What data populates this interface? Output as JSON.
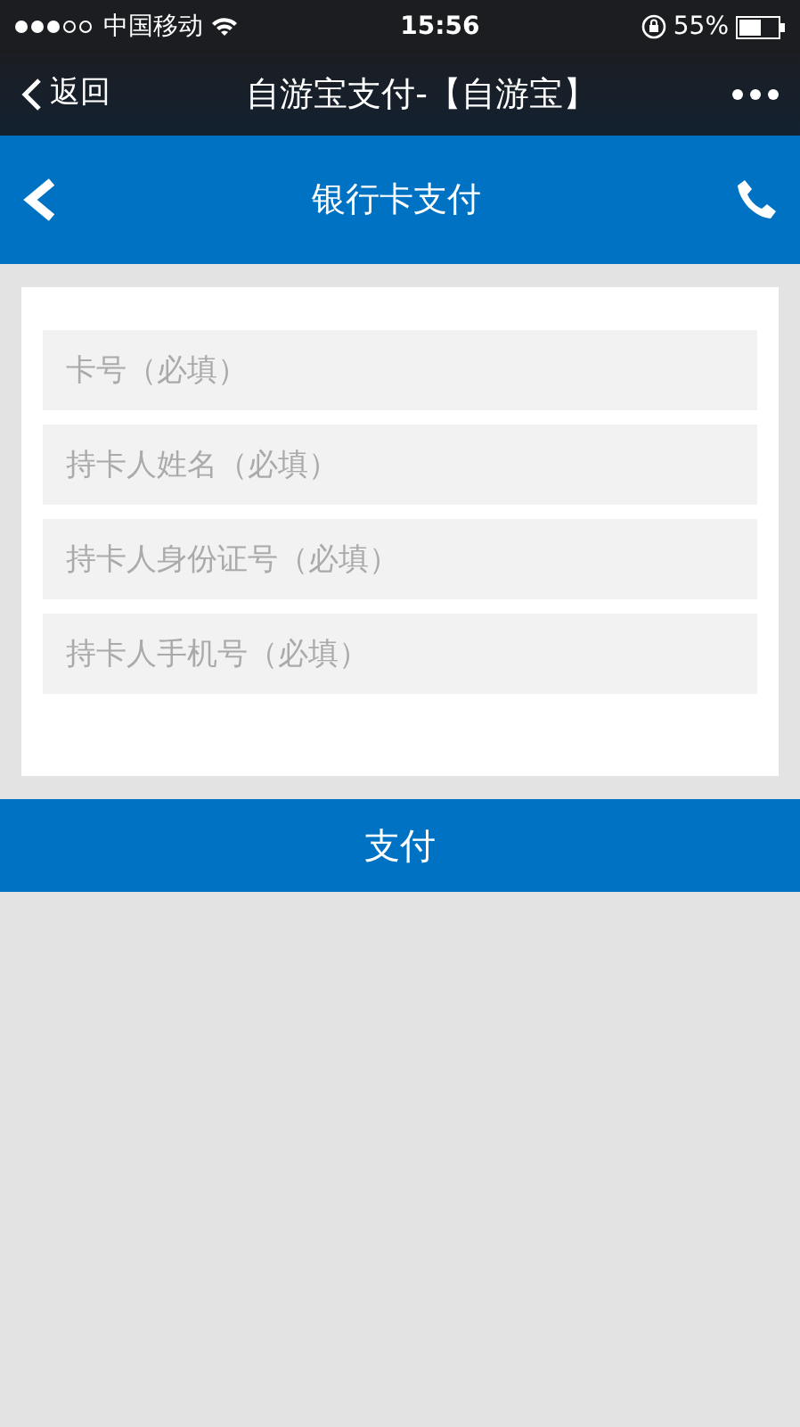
{
  "status_bar": {
    "carrier": "中国移动",
    "time": "15:56",
    "battery": "55%"
  },
  "nav_bar": {
    "back": "返回",
    "title": "自游宝支付-【自游宝】"
  },
  "header": {
    "title": "银行卡支付"
  },
  "form": {
    "fields": [
      {
        "placeholder": "卡号（必填）"
      },
      {
        "placeholder": "持卡人姓名（必填）"
      },
      {
        "placeholder": "持卡人身份证号（必填）"
      },
      {
        "placeholder": "持卡人手机号（必填）"
      }
    ]
  },
  "pay_button": "支付"
}
